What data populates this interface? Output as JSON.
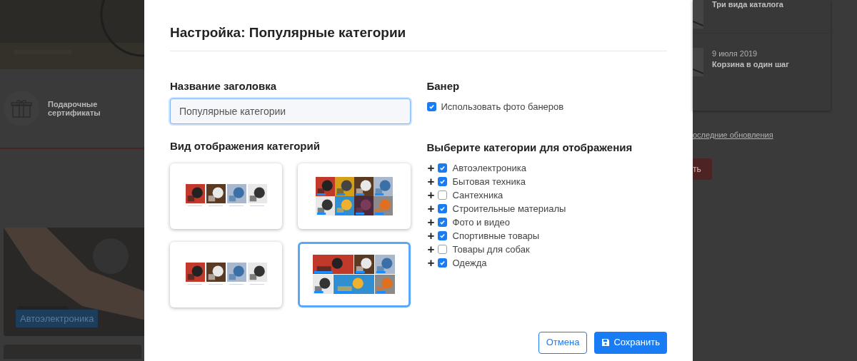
{
  "background": {
    "left": {
      "gift_card": "Подарочные сертификаты",
      "category_badge": "Автоэлектроника"
    },
    "right": {
      "news": [
        {
          "title": "Три вида каталога"
        },
        {
          "date": "9 июля 2019",
          "title": "Корзина в один шаг"
        }
      ],
      "updates_link": "оследние обновления",
      "button": "ть"
    }
  },
  "dialog": {
    "title": "Настройка: Популярные категории",
    "heading_field": {
      "label": "Название заголовка",
      "value": "Популярные категории"
    },
    "layout": {
      "label": "Вид отображения категорий",
      "options": [
        {
          "kind": "row",
          "selected": false
        },
        {
          "kind": "grid",
          "selected": false
        },
        {
          "kind": "row-captions",
          "selected": false
        },
        {
          "kind": "mosaic",
          "selected": true
        }
      ]
    },
    "banner": {
      "label": "Банер",
      "option": {
        "label": "Использовать фото банеров",
        "checked": true
      }
    },
    "categories": {
      "label": "Выберите категории для отображения",
      "expand_symbol": "+",
      "items": [
        {
          "label": "Автоэлектроника",
          "checked": true
        },
        {
          "label": "Бытовая техника",
          "checked": true
        },
        {
          "label": "Сантехника",
          "checked": false
        },
        {
          "label": "Строительные материалы",
          "checked": true
        },
        {
          "label": "Фото и видео",
          "checked": true
        },
        {
          "label": "Спортивные товары",
          "checked": true
        },
        {
          "label": "Товары для собак",
          "checked": false
        },
        {
          "label": "Одежда",
          "checked": true
        }
      ]
    },
    "buttons": {
      "cancel": "Отмена",
      "save": "Сохранить"
    }
  }
}
